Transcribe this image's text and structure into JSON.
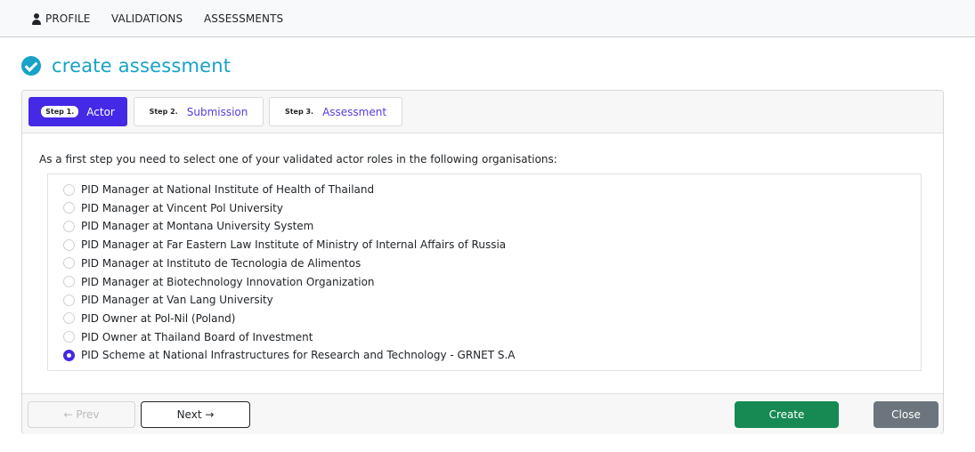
{
  "nav": {
    "profile": "PROFILE",
    "validations": "VALIDATIONS",
    "assessments": "ASSESSMENTS"
  },
  "page": {
    "title": "create assessment",
    "icon": "check-circle-icon"
  },
  "steps": [
    {
      "badge": "Step 1.",
      "label": "Actor",
      "active": true
    },
    {
      "badge": "Step 2.",
      "label": "Submission",
      "active": false
    },
    {
      "badge": "Step 3.",
      "label": "Assessment",
      "active": false
    }
  ],
  "instruction": "As a first step you need to select one of your validated actor roles in the following organisations:",
  "options": [
    {
      "label": "PID Manager at National Institute of Health of Thailand",
      "checked": false
    },
    {
      "label": "PID Manager at Vincent Pol University",
      "checked": false
    },
    {
      "label": "PID Manager at Montana University System",
      "checked": false
    },
    {
      "label": "PID Manager at Far Eastern Law Institute of Ministry of Internal Affairs of Russia",
      "checked": false
    },
    {
      "label": "PID Manager at Instituto de Tecnologia de Alimentos",
      "checked": false
    },
    {
      "label": "PID Manager at Biotechnology Innovation Organization",
      "checked": false
    },
    {
      "label": "PID Manager at Van Lang University",
      "checked": false
    },
    {
      "label": "PID Owner at Pol-Nil (Poland)",
      "checked": false
    },
    {
      "label": "PID Owner at Thailand Board of Investment",
      "checked": false
    },
    {
      "label": "PID Scheme at National Infrastructures for Research and Technology - GRNET S.A",
      "checked": true
    }
  ],
  "footer": {
    "prev": "← Prev",
    "next": "Next →",
    "create": "Create",
    "close": "Close"
  },
  "colors": {
    "accent": "#17a2c8",
    "primary": "#4429e6",
    "success": "#168a52",
    "secondary": "#6c757d"
  }
}
